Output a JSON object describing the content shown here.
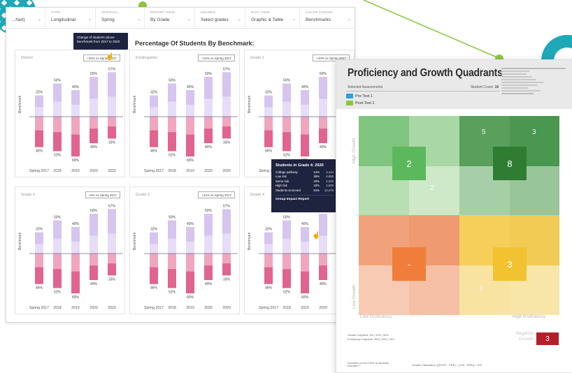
{
  "filters": [
    {
      "label": "",
      "value": "...hart)"
    },
    {
      "label": "Type:",
      "value": "Longitudinal"
    },
    {
      "label": "Interval:",
      "value": "Spring"
    },
    {
      "label": "Report view:",
      "value": "By Grade"
    },
    {
      "label": "Grades:",
      "value": "Select grades"
    },
    {
      "label": "Data view:",
      "value": "Graphic & Table"
    },
    {
      "label": "Color coding:",
      "value": "Benchmarks"
    }
  ],
  "dashboard": {
    "title": "Percentage Of Students By Benchmark:",
    "tooltip": "Change of students above benchmark from 2017 to 2020"
  },
  "panels": [
    {
      "title": "District",
      "badge": "+33% vs Spring 2017",
      "ylabel": "Benchmark"
    },
    {
      "title": "Kindergarten",
      "badge": "+12% vs Spring 2017",
      "ylabel": "Benchmark"
    },
    {
      "title": "Grade 1",
      "badge": "+10% vs Spring 2017",
      "ylabel": "Benchmark"
    },
    {
      "title": "Grade 2",
      "badge": "+8% vs Spring 2017",
      "ylabel": "Benchmark"
    },
    {
      "title": "Grade 3",
      "badge": "+11% vs Spring 2017",
      "ylabel": "Benchmark"
    },
    {
      "title": "Grade 4",
      "badge": "",
      "ylabel": "Benchmark"
    }
  ],
  "chart_data": {
    "type": "bar",
    "categories": [
      "Spring 2017",
      "2018",
      "2019",
      "2020",
      "2020"
    ],
    "above_labels": [
      "32%",
      "50%",
      "40%",
      "60%",
      "67%"
    ],
    "below_labels": [
      "46%",
      "52%",
      "60%",
      "40%",
      "33%"
    ]
  },
  "student_popup": {
    "title": "Students in Grade 4: 2020",
    "rows": [
      {
        "label": "College pathway",
        "pct": "24%",
        "n": "3,144"
      },
      {
        "label": "Low risk",
        "pct": "38%",
        "n": "4,850"
      },
      {
        "label": "Some risk",
        "pct": "28%",
        "n": "4,000"
      },
      {
        "label": "High risk",
        "pct": "18%",
        "n": "2,500"
      },
      {
        "label": "Students screened",
        "pct": "94%",
        "n": "12,478"
      }
    ],
    "link": "Group Impact Report"
  },
  "quadrant_report": {
    "title": "Proficiency and Growth Quadrants",
    "selected_label": "Selected Assessments",
    "student_count_label": "Student Count:",
    "student_count": "18",
    "tests": [
      {
        "name": "Pre-Test 1",
        "color": "#2e9fd8"
      },
      {
        "name": "Post-Test 2",
        "color": "#8dc63f"
      }
    ],
    "axis_high_growth": "High Growth",
    "axis_low_growth": "Low Growth",
    "axis_low_prof": "Low Proficiency",
    "axis_high_prof": "High Proficiency",
    "q_tl": "2",
    "q_tl_sub": "2",
    "q_tr": "8",
    "q_tr_a": "5",
    "q_tr_b": "3",
    "q_bl": "-",
    "q_br": "3",
    "q_br_sub": "2",
    "negative_label": "Negative Growth",
    "negative_value": "3",
    "cutpoints_growth": "Growth Cutpoints: 5% | 10% | 30%",
    "cutpoints_prof": "Proficiency Cutpoints: 35% | 50% | 75%",
    "growth_calc": "Growth Calculation: ((POST - PRE) ÷ (100 - PRE)) * 100",
    "footer_left": "Generated on 02/17/2021 by Illuminate Education™"
  },
  "colors": {
    "accent_teal": "#1fa8b8",
    "accent_green": "#8dc63f",
    "above_bar": "#d5c5ef",
    "below_bar": "#e0648f",
    "quad_green": "#5cb85c",
    "quad_darkgreen": "#2e7d32",
    "quad_orange": "#f07e3a",
    "quad_yellow": "#f2c230",
    "negative": "#b31f2a"
  }
}
